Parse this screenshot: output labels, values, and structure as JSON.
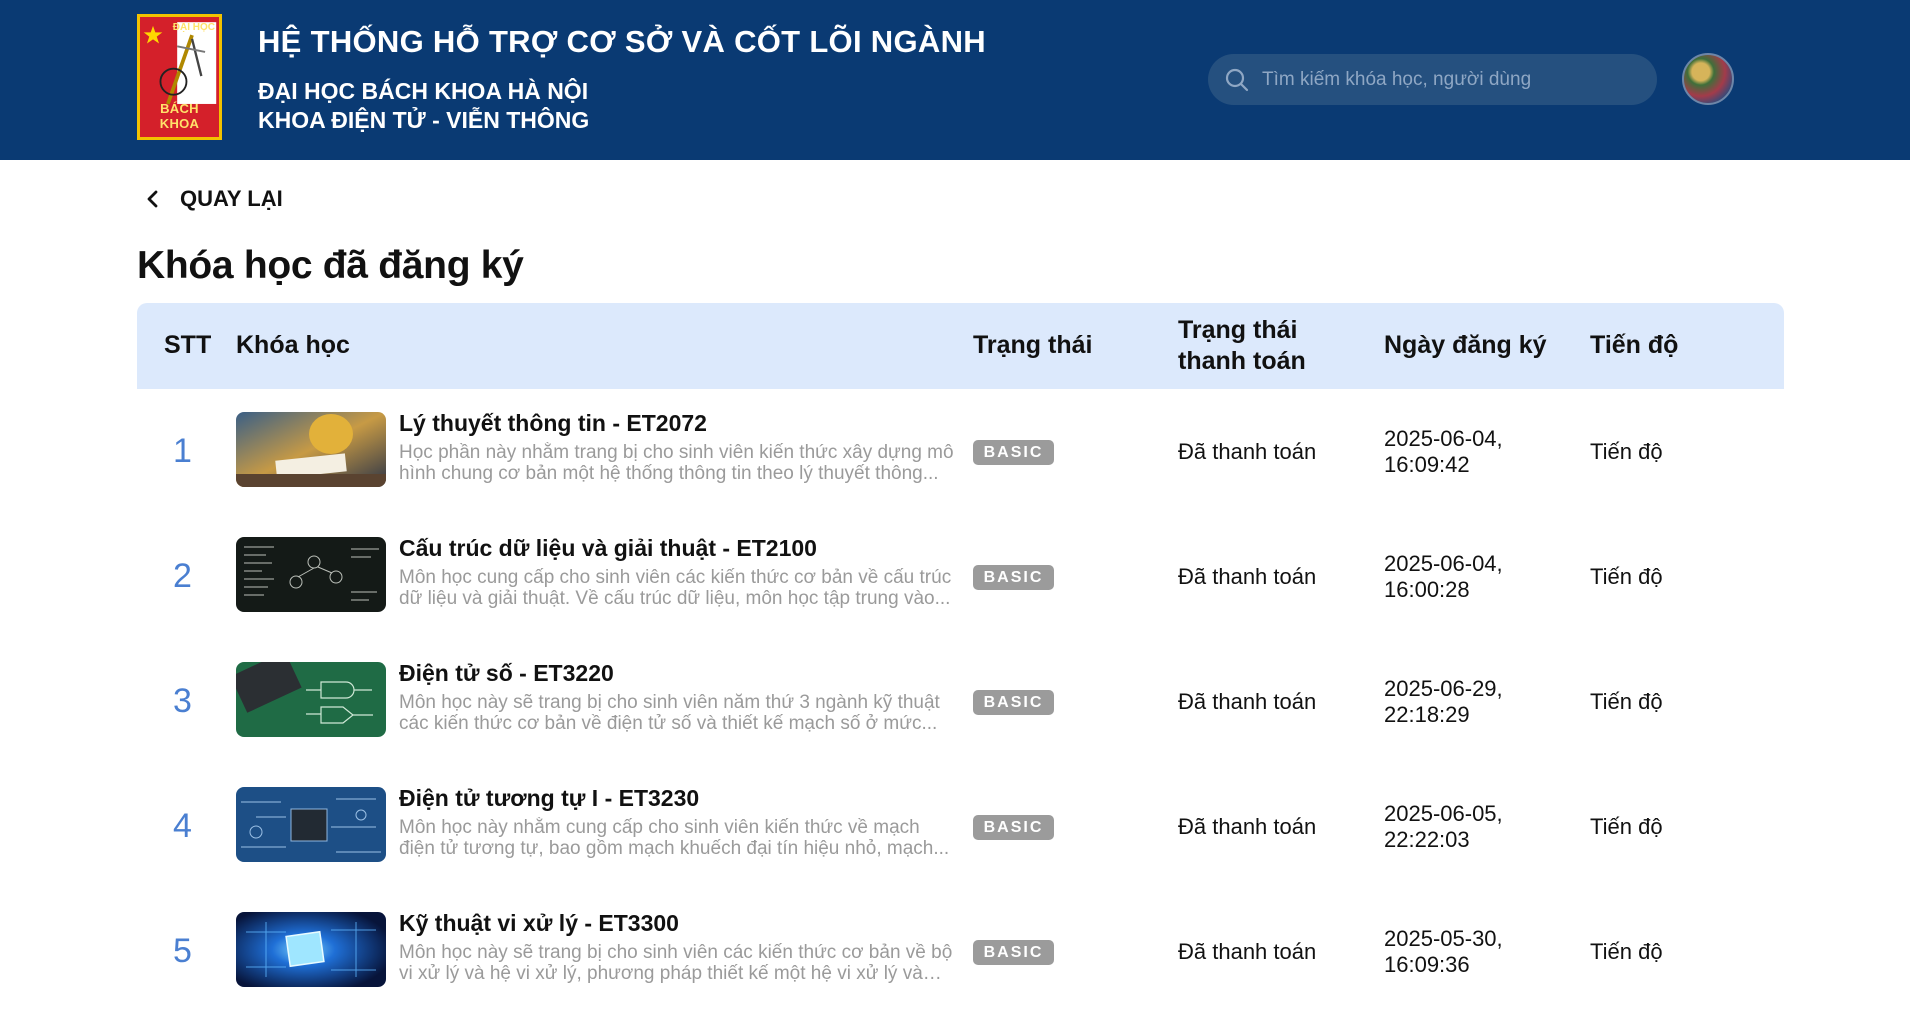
{
  "header": {
    "logo": {
      "top_text": "ĐẠI HỌC",
      "bottom_text": "BÁCH KHOA"
    },
    "title": "HỆ THỐNG HỖ TRỢ CƠ SỞ VÀ CỐT LÕI NGÀNH",
    "subtitle_1": "ĐẠI HỌC BÁCH KHOA HÀ NỘI",
    "subtitle_2": "KHOA ĐIỆN TỬ - VIỄN THÔNG",
    "search_placeholder": "Tìm kiếm khóa học, người dùng",
    "search_icon": "search-icon",
    "avatar_icon": "user-avatar"
  },
  "nav": {
    "back_label": "QUAY LẠI",
    "back_icon": "chevron-left-icon"
  },
  "page": {
    "title": "Khóa học đã đăng ký"
  },
  "table": {
    "headers": {
      "stt": "STT",
      "course": "Khóa học",
      "status": "Trạng thái",
      "payment_status": "Trạng thái thanh toán",
      "registered_date": "Ngày đăng ký",
      "progress": "Tiến độ"
    },
    "rows": [
      {
        "index": "1",
        "title": "Lý thuyết thông tin - ET2072",
        "description": "Học phần này nhằm trang bị cho sinh viên kiến thức xây dựng mô hình chung cơ bản một hệ thống thông tin theo lý thuyết thông...",
        "badge": "BASIC",
        "payment": "Đã thanh toán",
        "date": "2025-06-04, 16:09:42",
        "progress": "Tiến độ"
      },
      {
        "index": "2",
        "title": "Cấu trúc dữ liệu và giải thuật - ET2100",
        "description": "Môn học cung cấp cho sinh viên các kiến thức cơ bản về cấu trúc dữ liệu và giải thuật. Về cấu trúc dữ liệu, môn học tập trung vào...",
        "badge": "BASIC",
        "payment": "Đã thanh toán",
        "date": "2025-06-04, 16:00:28",
        "progress": "Tiến độ"
      },
      {
        "index": "3",
        "title": "Điện tử số - ET3220",
        "description": "Môn học này sẽ trang bị cho sinh viên năm thứ 3 ngành kỹ thuật các kiến thức cơ bản về điện tử số và thiết kế mạch số ở mức...",
        "badge": "BASIC",
        "payment": "Đã thanh toán",
        "date": "2025-06-29, 22:18:29",
        "progress": "Tiến độ"
      },
      {
        "index": "4",
        "title": "Điện tử tương tự I - ET3230",
        "description": "Môn học này nhằm cung cấp cho sinh viên kiến thức về mạch điện tử tương tự, bao gồm mạch khuếch đại tín hiệu nhỏ, mạch...",
        "badge": "BASIC",
        "payment": "Đã thanh toán",
        "date": "2025-06-05, 22:22:03",
        "progress": "Tiến độ"
      },
      {
        "index": "5",
        "title": "Kỹ thuật vi xử lý - ET3300",
        "description": "Môn học này sẽ trang bị cho sinh viên các kiến thức cơ bản về bộ vi xử lý và hệ vi xử lý, phương pháp thiết kế một hệ vi xử lý và kỹ...",
        "badge": "BASIC",
        "payment": "Đã thanh toán",
        "date": "2025-05-30, 16:09:36",
        "progress": "Tiến độ"
      }
    ]
  },
  "colors": {
    "header_bg": "#0a3a73",
    "table_header_bg": "#dce9fc",
    "index_color": "#4a7fd1",
    "badge_bg": "#9b9b9b"
  }
}
